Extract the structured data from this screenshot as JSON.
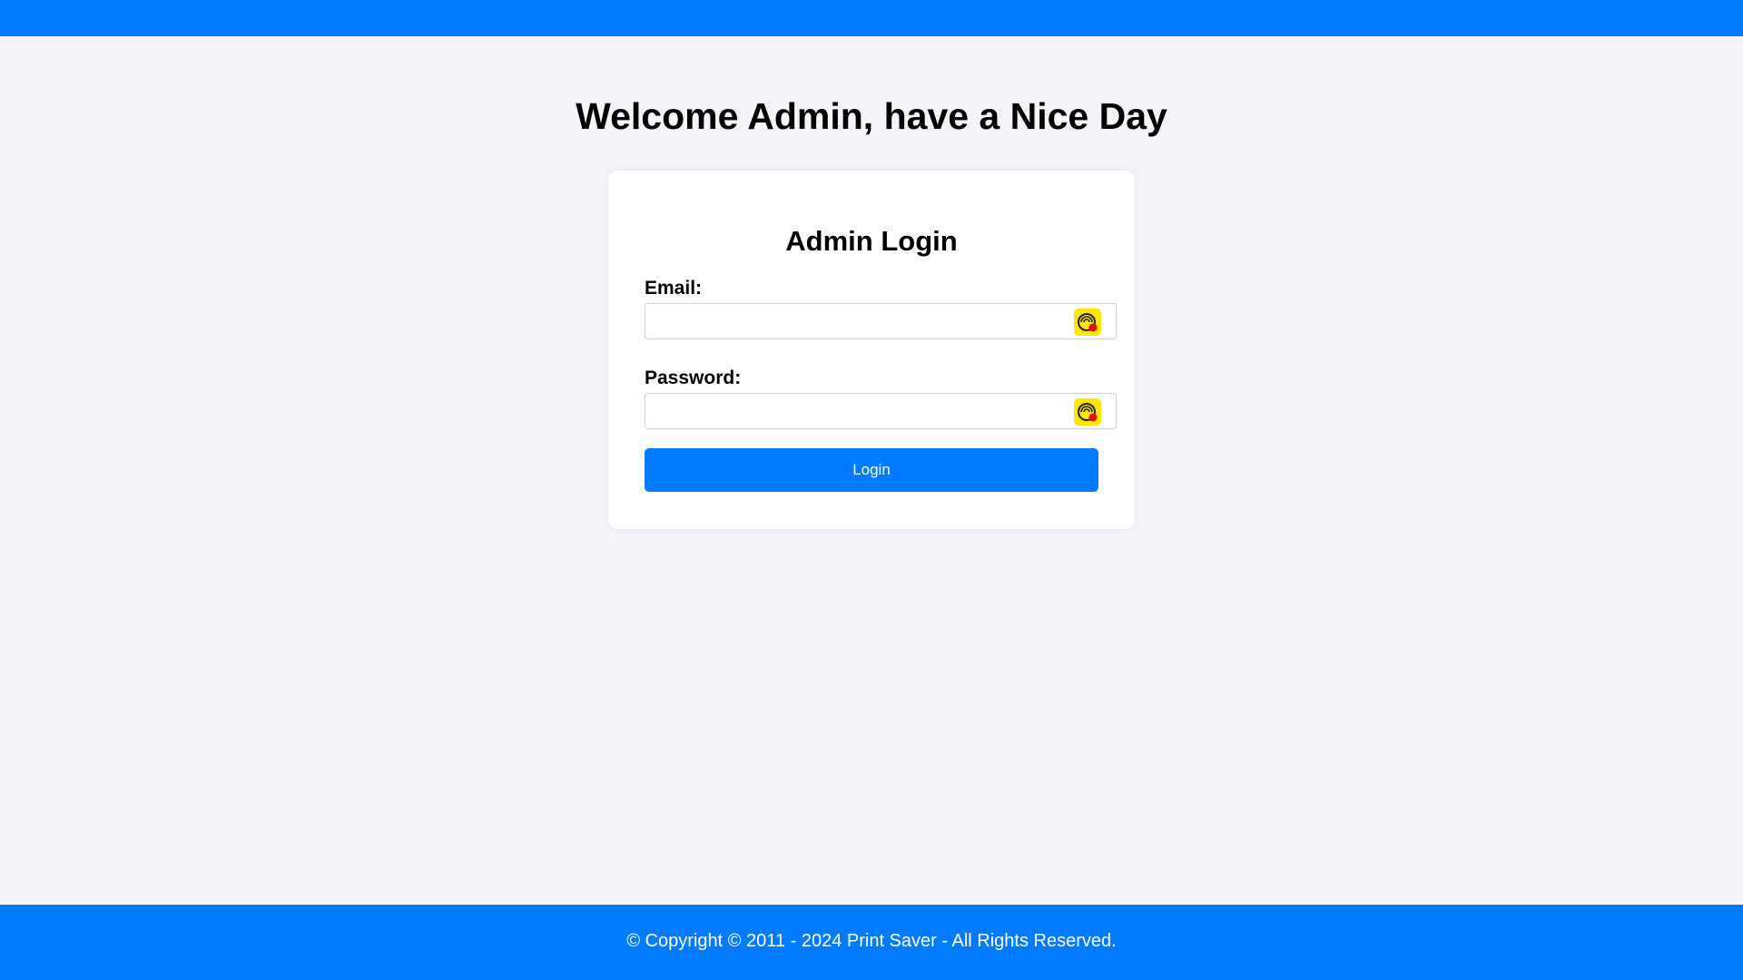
{
  "header": {
    "welcome": "Welcome Admin, have a Nice Day"
  },
  "login_card": {
    "title": "Admin Login",
    "email_label": "Email:",
    "email_value": "",
    "password_label": "Password:",
    "password_value": "",
    "login_button": "Login",
    "field_icon": "password-manager-extension-icon"
  },
  "footer": {
    "text": "© Copyright © 2011 - 2024 Print Saver - All Rights Reserved."
  },
  "colors": {
    "accent": "#007bff",
    "background": "#f4f4f9",
    "card": "#ffffff",
    "extension_icon": "#ffe600"
  }
}
